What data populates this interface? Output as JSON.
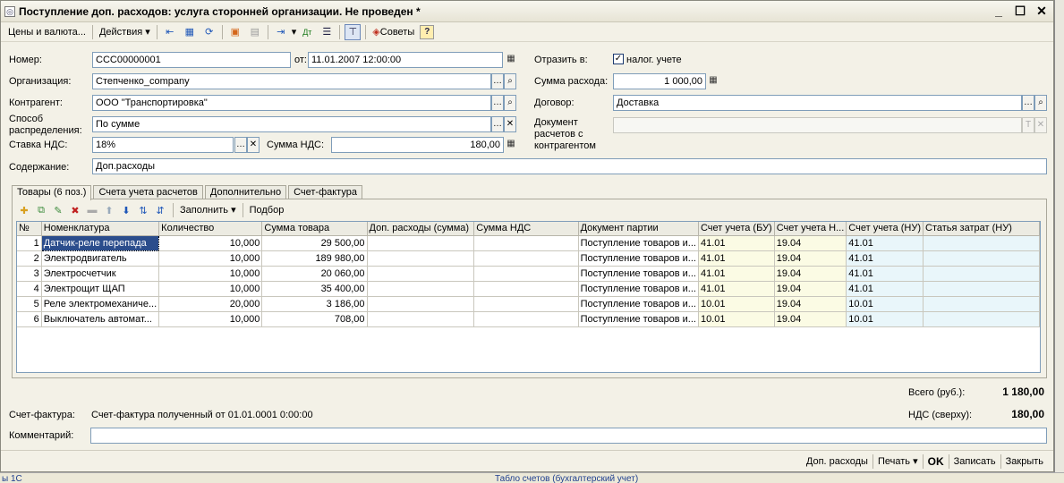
{
  "window": {
    "title": "Поступление доп. расходов: услуга сторонней организации. Не проведен *",
    "buttons": {
      "minimize": "_",
      "maximize": "☐",
      "close": "✕"
    }
  },
  "toolbar": {
    "prices_label": "Цены и валюта...",
    "actions_label": "Действия",
    "dropdown_arrow": "▾",
    "tips_label": "Советы",
    "help_label": "?"
  },
  "form": {
    "number_label": "Номер:",
    "number_value": "ССС00000001",
    "date_label": "от:",
    "date_value": "11.01.2007 12:00:00",
    "reflect_label": "Отразить в:",
    "tax_accounting_label": "налог. учете",
    "tax_accounting_checked": "✓",
    "org_label": "Организация:",
    "org_value": "Степченко_company",
    "expense_sum_label": "Сумма расхода:",
    "expense_sum_value": "1 000,00",
    "contractor_label": "Контрагент:",
    "contractor_value": "ООО \"Транспортировка\"",
    "contract_label": "Договор:",
    "contract_value": "Доставка",
    "distribution_label_1": "Способ",
    "distribution_label_2": "распределения:",
    "distribution_value": "По сумме",
    "settlement_doc_label_1": "Документ",
    "settlement_doc_label_2": "расчетов с",
    "settlement_doc_label_3": "контрагентом",
    "settlement_doc_value": "",
    "vat_rate_label": "Ставка НДС:",
    "vat_rate_value": "18%",
    "vat_sum_label": "Сумма НДС:",
    "vat_sum_value": "180,00",
    "content_label": "Содержание:",
    "content_value": "Доп.расходы"
  },
  "tabs": [
    {
      "label": "Товары (6 поз.)"
    },
    {
      "label": "Счета учета расчетов"
    },
    {
      "label": "Дополнительно"
    },
    {
      "label": "Счет-фактура"
    }
  ],
  "grid_toolbar": {
    "fill_label": "Заполнить",
    "selection_label": "Подбор"
  },
  "grid": {
    "columns": [
      "№",
      "Номенклатура",
      "Количество",
      "Сумма товара",
      "Доп. расходы (сумма)",
      "Сумма НДС",
      "Документ партии",
      "Счет учета (БУ)",
      "Счет учета Н...",
      "Счет учета (НУ)",
      "Статья затрат (НУ)"
    ],
    "rows": [
      [
        "1",
        "Датчик-реле перепада",
        "10,000",
        "29 500,00",
        "",
        "",
        "Поступление товаров и...",
        "41.01",
        "19.04",
        "41.01",
        ""
      ],
      [
        "2",
        "Электродвигатель",
        "10,000",
        "189 980,00",
        "",
        "",
        "Поступление товаров и...",
        "41.01",
        "19.04",
        "41.01",
        ""
      ],
      [
        "3",
        "Электросчетчик",
        "10,000",
        "20 060,00",
        "",
        "",
        "Поступление товаров и...",
        "41.01",
        "19.04",
        "41.01",
        ""
      ],
      [
        "4",
        "Электрощит ЩАП",
        "10,000",
        "35 400,00",
        "",
        "",
        "Поступление товаров и...",
        "41.01",
        "19.04",
        "41.01",
        ""
      ],
      [
        "5",
        "Реле электромеханиче...",
        "20,000",
        "3 186,00",
        "",
        "",
        "Поступление товаров и...",
        "10.01",
        "19.04",
        "10.01",
        ""
      ],
      [
        "6",
        "Выключатель автомат...",
        "10,000",
        "708,00",
        "",
        "",
        "Поступление товаров и...",
        "10.01",
        "19.04",
        "10.01",
        ""
      ]
    ]
  },
  "totals": {
    "total_label": "Всего (руб.):",
    "total_value": "1 180,00",
    "vat_label": "НДС (сверху):",
    "vat_value": "180,00"
  },
  "invoice": {
    "label": "Счет-фактура:",
    "value": "Счет-фактура полученный  от 01.01.0001 0:00:00"
  },
  "comment": {
    "label": "Комментарий:",
    "value": ""
  },
  "bottom_buttons": {
    "extra_expenses": "Доп. расходы",
    "print": "Печать",
    "ok": "OK",
    "save": "Записать",
    "close": "Закрыть"
  },
  "background": {
    "taskbar_left": "ы 1С",
    "taskbar_item": "Табло счетов (бухгалтерский учет)"
  }
}
